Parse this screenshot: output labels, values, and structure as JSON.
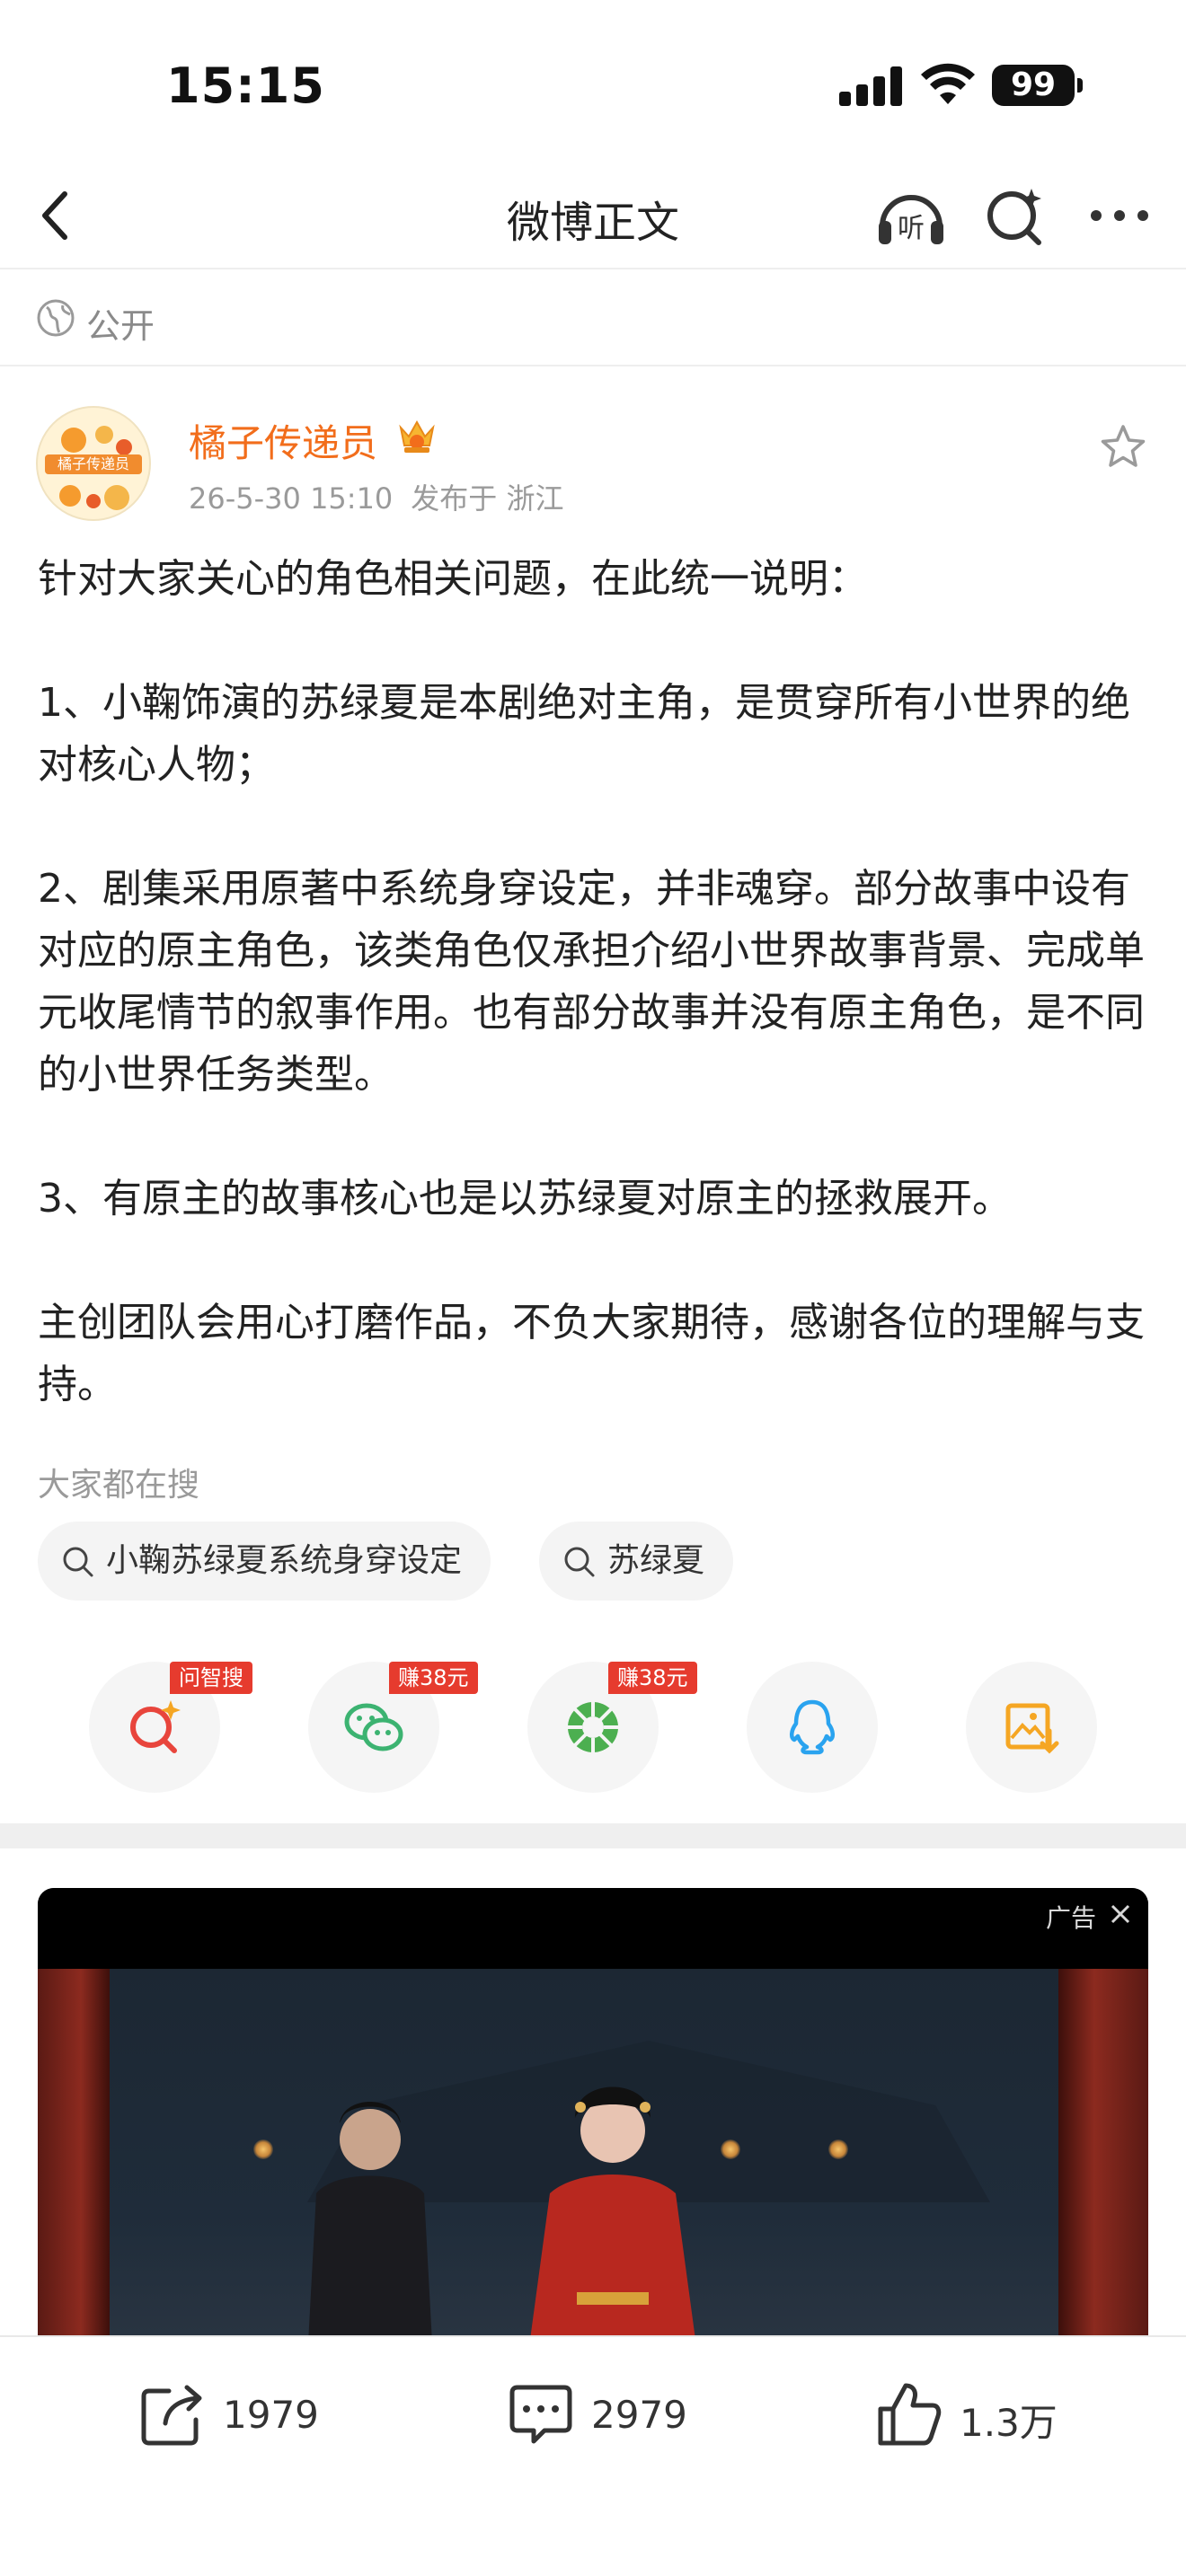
{
  "status_bar": {
    "time": "15:15",
    "battery": "99"
  },
  "nav": {
    "title": "微博正文",
    "listen_label": "听"
  },
  "visibility": {
    "label": "公开"
  },
  "post": {
    "author": "橘子传递员",
    "avatar_text": "橘子传递员",
    "time": "26-5-30 15:10",
    "location": "发布于 浙江",
    "paragraphs": [
      "针对大家关心的角色相关问题，在此统一说明：",
      "1、小鞠饰演的苏绿夏是本剧绝对主角，是贯穿所有小世界的绝对核心人物；",
      "2、剧集采用原著中系统身穿设定，并非魂穿。部分故事中设有对应的原主角色，该类角色仅承担介绍小世界故事背景、完成单元收尾情节的叙事作用。也有部分故事并没有原主角色，是不同的小世界任务类型。",
      "3、有原主的故事核心也是以苏绿夏对原主的拯救展开。",
      "主创团队会用心打磨作品，不负大家期待，感谢各位的理解与支持。"
    ]
  },
  "searches": {
    "title": "大家都在搜",
    "chips": [
      "小鞠苏绿夏系统身穿设定",
      "苏绿夏"
    ]
  },
  "share": {
    "items": [
      {
        "icon": "zhisou-search-icon",
        "badge": "问智搜"
      },
      {
        "icon": "wechat-icon",
        "badge": "赚38元"
      },
      {
        "icon": "moments-icon",
        "badge": "赚38元"
      },
      {
        "icon": "qq-icon",
        "badge": ""
      },
      {
        "icon": "save-image-icon",
        "badge": ""
      }
    ]
  },
  "ad": {
    "label": "广告"
  },
  "actions": {
    "repost_count": "1979",
    "comment_count": "2979",
    "like_count": "1.3万"
  },
  "colors": {
    "accent": "#f26d1b",
    "badge": "#e63b2e",
    "wechat": "#3cb371",
    "qq": "#2aa3ef",
    "save": "#f5a623"
  }
}
